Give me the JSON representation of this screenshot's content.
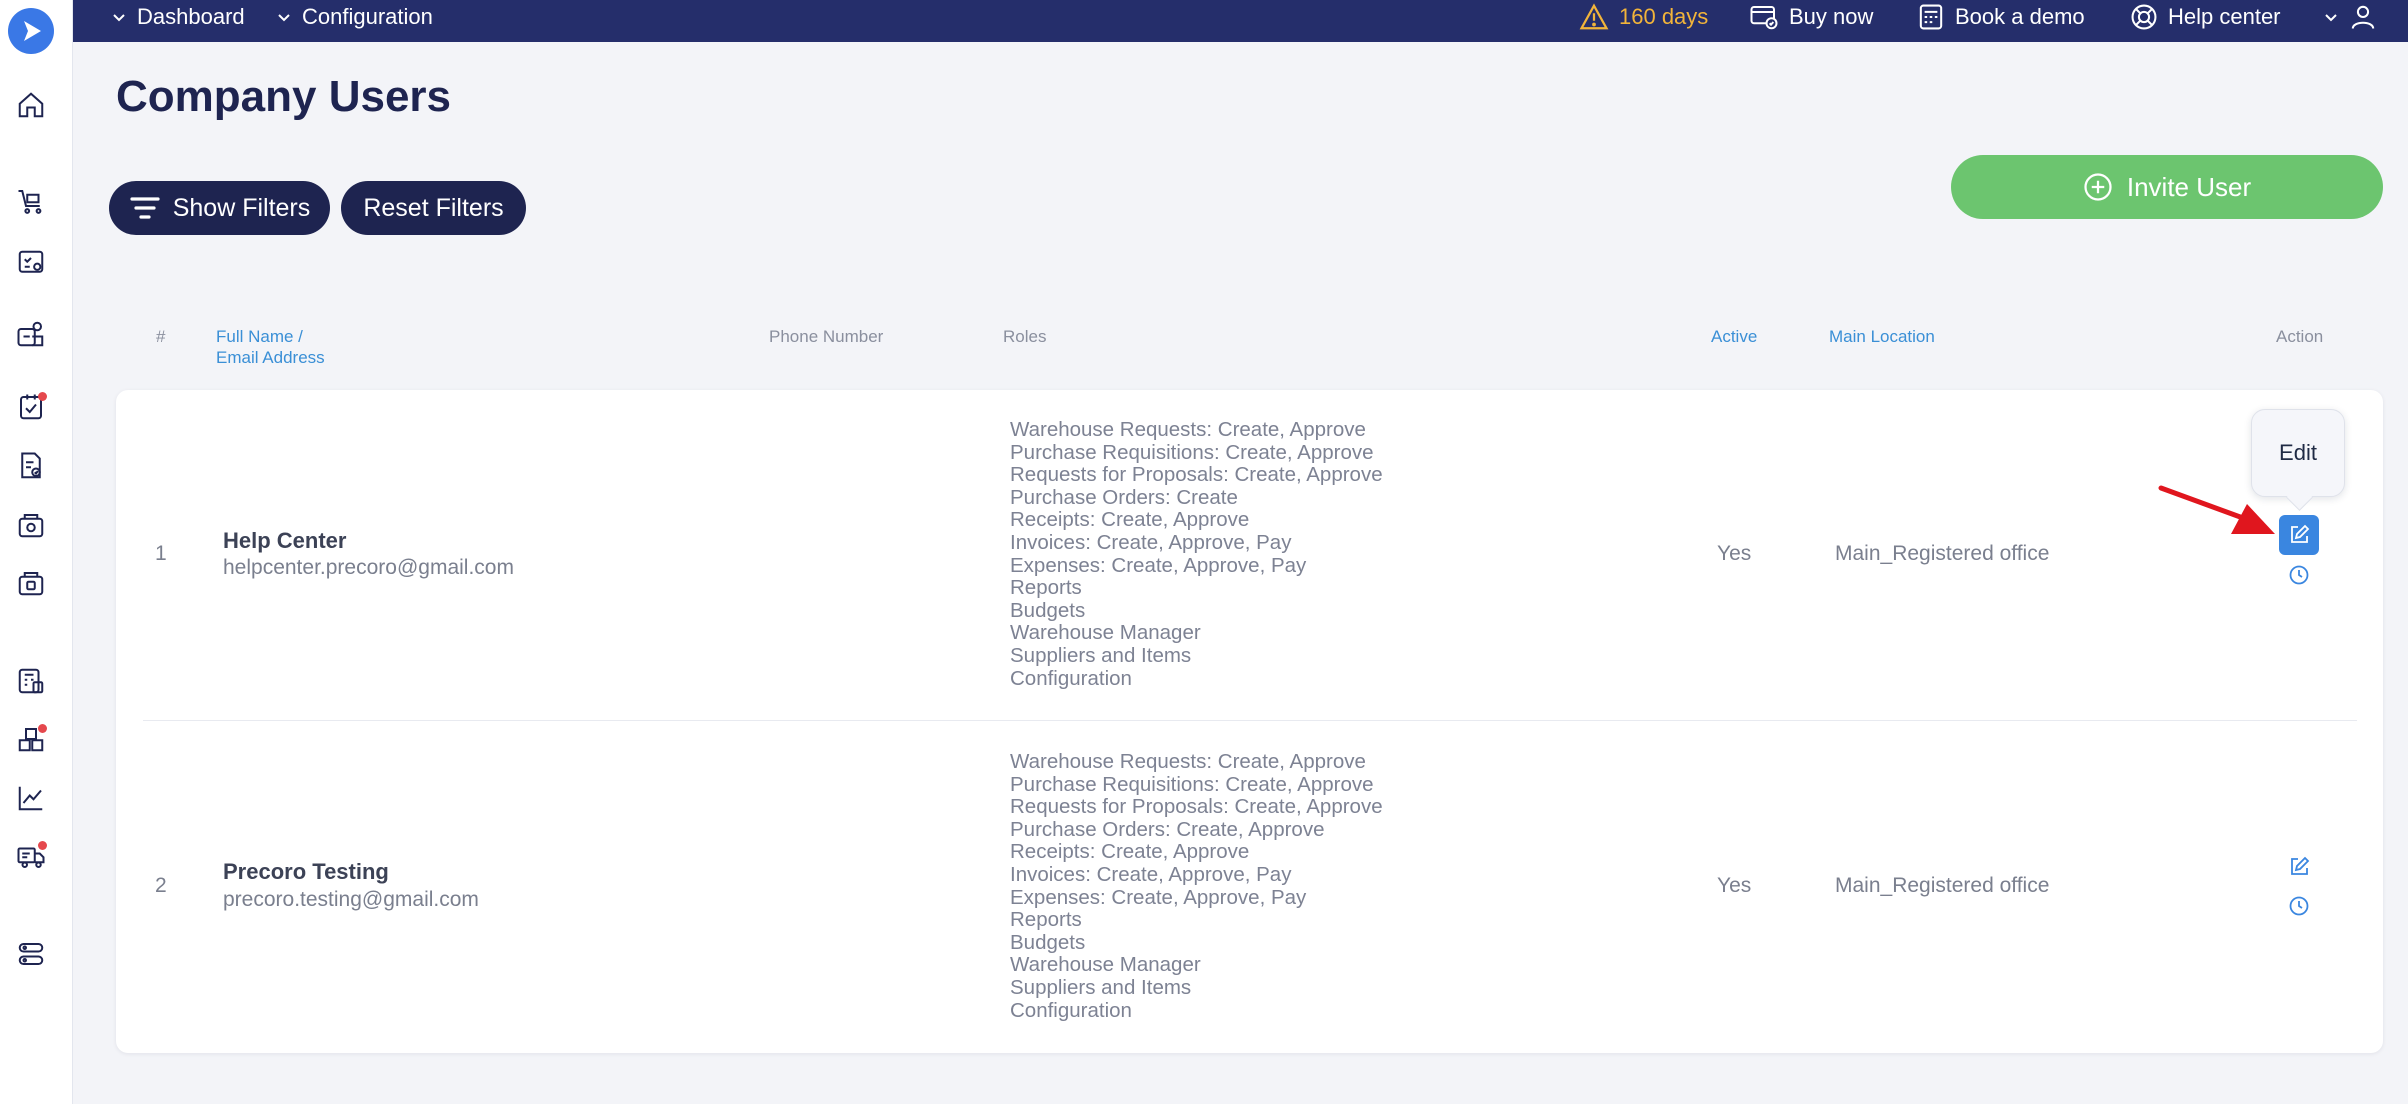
{
  "topbar": {
    "dashboard": "Dashboard",
    "configuration": "Configuration",
    "trial": "160 days",
    "buy_now": "Buy now",
    "book_demo": "Book a demo",
    "help_center": "Help center"
  },
  "sidebar": {
    "icons": [
      "home-icon",
      "cart-icon",
      "requests-icon",
      "users-icon",
      "approvals-icon",
      "invoice-icon",
      "receipt-icon",
      "wallet-icon",
      "budget-icon",
      "inventory-icon",
      "analytics-icon",
      "delivery-icon",
      "settings-icon"
    ],
    "badge_color": "#e5484d"
  },
  "page": {
    "title": "Company Users",
    "show_filters": "Show Filters",
    "reset_filters": "Reset Filters",
    "invite_user": "Invite User"
  },
  "table": {
    "headers": {
      "num": "#",
      "name_line1": "Full Name /",
      "name_line2": "Email Address",
      "phone": "Phone Number",
      "roles": "Roles",
      "active": "Active",
      "location": "Main Location",
      "action": "Action"
    },
    "rows": [
      {
        "num": "1",
        "name": "Help Center",
        "email": "helpcenter.precoro@gmail.com",
        "phone": "",
        "roles": [
          "Warehouse Requests: Create, Approve",
          "Purchase Requisitions: Create, Approve",
          "Requests for Proposals: Create, Approve",
          "Purchase Orders: Create",
          "Receipts: Create, Approve",
          "Invoices: Create, Approve, Pay",
          "Expenses: Create, Approve, Pay",
          "Reports",
          "Budgets",
          "Warehouse Manager",
          "Suppliers and Items",
          "Configuration"
        ],
        "active": "Yes",
        "location": "Main_Registered office"
      },
      {
        "num": "2",
        "name": "Precoro Testing",
        "email": "precoro.testing@gmail.com",
        "phone": "",
        "roles": [
          "Warehouse Requests: Create, Approve",
          "Purchase Requisitions: Create, Approve",
          "Requests for Proposals: Create, Approve",
          "Purchase Orders: Create, Approve",
          "Receipts: Create, Approve",
          "Invoices: Create, Approve, Pay",
          "Expenses: Create, Approve, Pay",
          "Reports",
          "Budgets",
          "Warehouse Manager",
          "Suppliers and Items",
          "Configuration"
        ],
        "active": "Yes",
        "location": "Main_Registered office"
      }
    ]
  },
  "tooltip": {
    "edit": "Edit"
  },
  "colors": {
    "topbar": "#252e6b",
    "primary_dark": "#1e2450",
    "invite_green": "#6cc56f",
    "link_blue": "#3a8fd6",
    "trial_orange": "#f2b43a",
    "arrow_red": "#e0161e"
  }
}
